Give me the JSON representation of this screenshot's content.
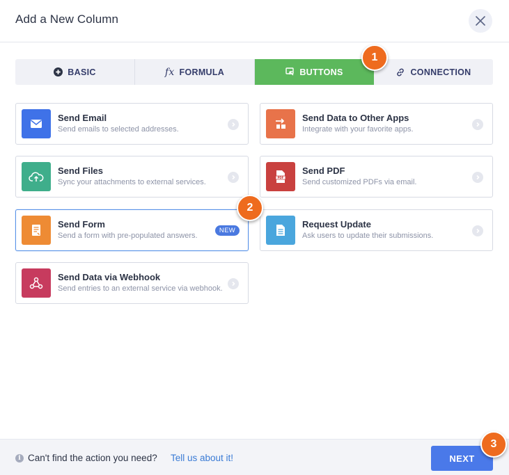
{
  "dialog": {
    "title": "Add a New Column"
  },
  "tabs": [
    {
      "label": "BASIC",
      "icon": "plus-circle-icon",
      "active": false
    },
    {
      "label": "FORMULA",
      "icon": "function-icon",
      "glyph": "fx",
      "active": false
    },
    {
      "label": "BUTTONS",
      "icon": "cursor-click-icon",
      "active": true
    },
    {
      "label": "CONNECTION",
      "icon": "link-icon",
      "active": false
    }
  ],
  "actions": [
    {
      "title": "Send Email",
      "description": "Send emails to selected addresses.",
      "icon": "envelope-icon",
      "color": "#3f72e8"
    },
    {
      "title": "Send Data to Other Apps",
      "description": "Integrate with your favorite apps.",
      "icon": "transfer-icon",
      "color": "#e8734a"
    },
    {
      "title": "Send Files",
      "description": "Sync your attachments to external services.",
      "icon": "cloud-upload-icon",
      "color": "#3fae8b"
    },
    {
      "title": "Send PDF",
      "description": "Send customized PDFs via email.",
      "icon": "pdf-file-icon",
      "color": "#c9413f"
    },
    {
      "title": "Send Form",
      "description": "Send a form with pre-populated answers.",
      "icon": "form-icon",
      "color": "#ee8b34",
      "badge": "NEW",
      "selected": true
    },
    {
      "title": "Request Update",
      "description": "Ask users to update their submissions.",
      "icon": "document-icon",
      "color": "#4aa6dd"
    },
    {
      "title": "Send Data via Webhook",
      "description": "Send entries to an external service via webhook.",
      "icon": "webhook-icon",
      "color": "#c73b5e"
    }
  ],
  "steps": [
    "1",
    "2",
    "3"
  ],
  "footer": {
    "help_text": "Can't find the action you need?",
    "link_text": "Tell us about it!",
    "next_label": "NEXT"
  }
}
